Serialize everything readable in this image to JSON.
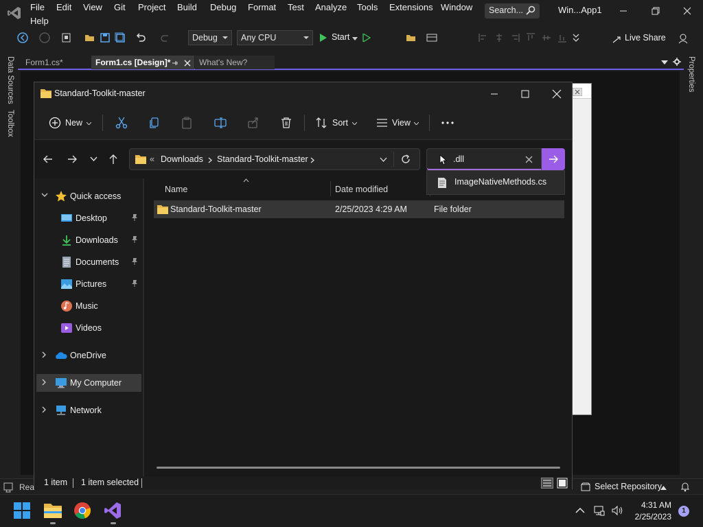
{
  "vs": {
    "menu": [
      "File",
      "Edit",
      "View",
      "Git",
      "Project",
      "Build",
      "Debug",
      "Format",
      "Test",
      "Analyze",
      "Tools",
      "Extensions",
      "Window",
      "Help"
    ],
    "search_placeholder": "Search...",
    "solution_name": "Win...App1",
    "config_value": "Debug",
    "platform_value": "Any CPU",
    "start_label": "Start",
    "live_share_label": "Live Share",
    "tabs": [
      {
        "label": "Form1.cs*",
        "active": false
      },
      {
        "label": "Form1.cs [Design]*",
        "active": true
      },
      {
        "label": "What's New?",
        "active": false
      }
    ],
    "left_panels": [
      "Data Sources",
      "Toolbox"
    ],
    "right_panels": [
      "Properties"
    ],
    "status_left": "Rea",
    "select_repository": "Select Repository",
    "accent_color": "#7160e8"
  },
  "explorer": {
    "title": "Standard-Toolkit-master",
    "toolbar": {
      "new_label": "New",
      "sort_label": "Sort",
      "view_label": "View"
    },
    "breadcrumb": [
      "Downloads",
      "Standard-Toolkit-master"
    ],
    "breadcrumb_overflow": "«",
    "search_value": ".dll",
    "search_suggestion": "ImageNativeMethods.cs",
    "nav": {
      "quick_access": "Quick access",
      "items": [
        {
          "label": "Desktop",
          "icon": "desktop-icon",
          "pinned": true
        },
        {
          "label": "Downloads",
          "icon": "downloads-icon",
          "pinned": true
        },
        {
          "label": "Documents",
          "icon": "documents-icon",
          "pinned": true
        },
        {
          "label": "Pictures",
          "icon": "pictures-icon",
          "pinned": true
        },
        {
          "label": "Music",
          "icon": "music-icon",
          "pinned": false
        },
        {
          "label": "Videos",
          "icon": "videos-icon",
          "pinned": false
        }
      ],
      "onedrive": "OneDrive",
      "my_computer": "My Computer",
      "network": "Network"
    },
    "columns": {
      "name": "Name",
      "date_modified": "Date modified"
    },
    "files": [
      {
        "name": "Standard-Toolkit-master",
        "date_modified": "2/25/2023 4:29 AM",
        "type": "File folder"
      }
    ],
    "status": {
      "count": "1 item",
      "selected": "1 item selected"
    },
    "accent_color": "#9b5de5"
  },
  "taskbar": {
    "apps": [
      "start-icon",
      "file-explorer-icon",
      "chrome-icon",
      "visual-studio-icon"
    ],
    "time": "4:31 AM",
    "date": "2/25/2023",
    "notification_count": "1"
  }
}
